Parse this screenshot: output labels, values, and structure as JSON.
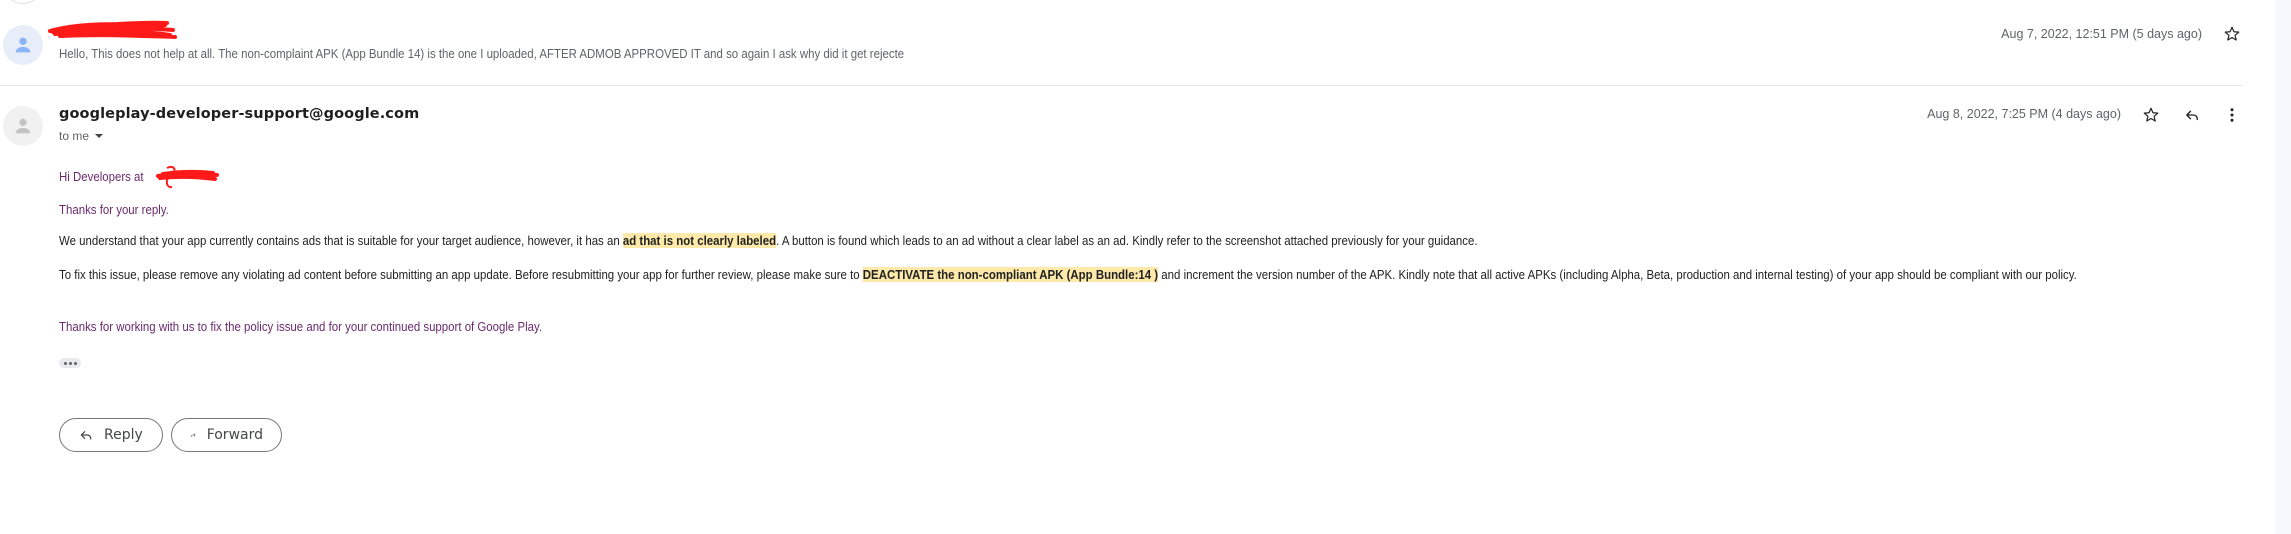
{
  "thread": {
    "messages": [
      {
        "sender": "[redacted]",
        "snippet": "Hello, This does not help at all. The non-complaint APK (App Bundle 14) is the one I uploaded, AFTER ADMOB APPROVED IT and so again I ask why did it get rejecte",
        "date": "Aug 7, 2022, 12:51 PM (5 days ago)",
        "avatar_icon": "person-icon",
        "actions": [
          {
            "icon": "star-icon",
            "label": "Star"
          }
        ]
      },
      {
        "sender": "googleplay-developer-support@google.com",
        "recipient": "to me",
        "date": "Aug 8, 2022, 7:25 PM (4 days ago)",
        "avatar_icon": "person-icon",
        "actions": [
          {
            "icon": "star-icon",
            "label": "Star"
          },
          {
            "icon": "reply-icon",
            "label": "Reply"
          },
          {
            "icon": "more-vert-icon",
            "label": "More"
          }
        ],
        "body": {
          "greeting": "Hi Developers at ",
          "greeting_redacted": "[redacted]",
          "thanks": "Thanks for your reply.",
          "p1_before": "We understand that your app currently contains ads that is suitable for your target audience, however, it has an ",
          "p1_highlight": "ad that is not clearly labeled",
          "p1_after": ". A button is found which leads to an ad without a clear label as an ad. Kindly refer to the screenshot attached previously for your guidance.",
          "p2_before": "To fix this issue, please remove any violating ad content before submitting an app update. Before resubmitting your app for further review, please make sure to ",
          "p2_highlight": "DEACTIVATE the non-compliant APK (App Bundle:14 )",
          "p2_after": " and increment the version number of the APK. Kindly note that all active APKs (including Alpha, Beta, production and internal testing) of your app should be compliant with our policy.",
          "closing": "Thanks for working with us to fix the policy issue and for your continued support of Google Play.",
          "show_trimmed_label": "Show trimmed content"
        }
      }
    ],
    "footer_actions": {
      "reply_label": "Reply",
      "forward_label": "Forward"
    }
  },
  "colors": {
    "highlight": "#fde9a9",
    "quoted_text": "#6b2a6e",
    "redaction": "#ff0000"
  }
}
